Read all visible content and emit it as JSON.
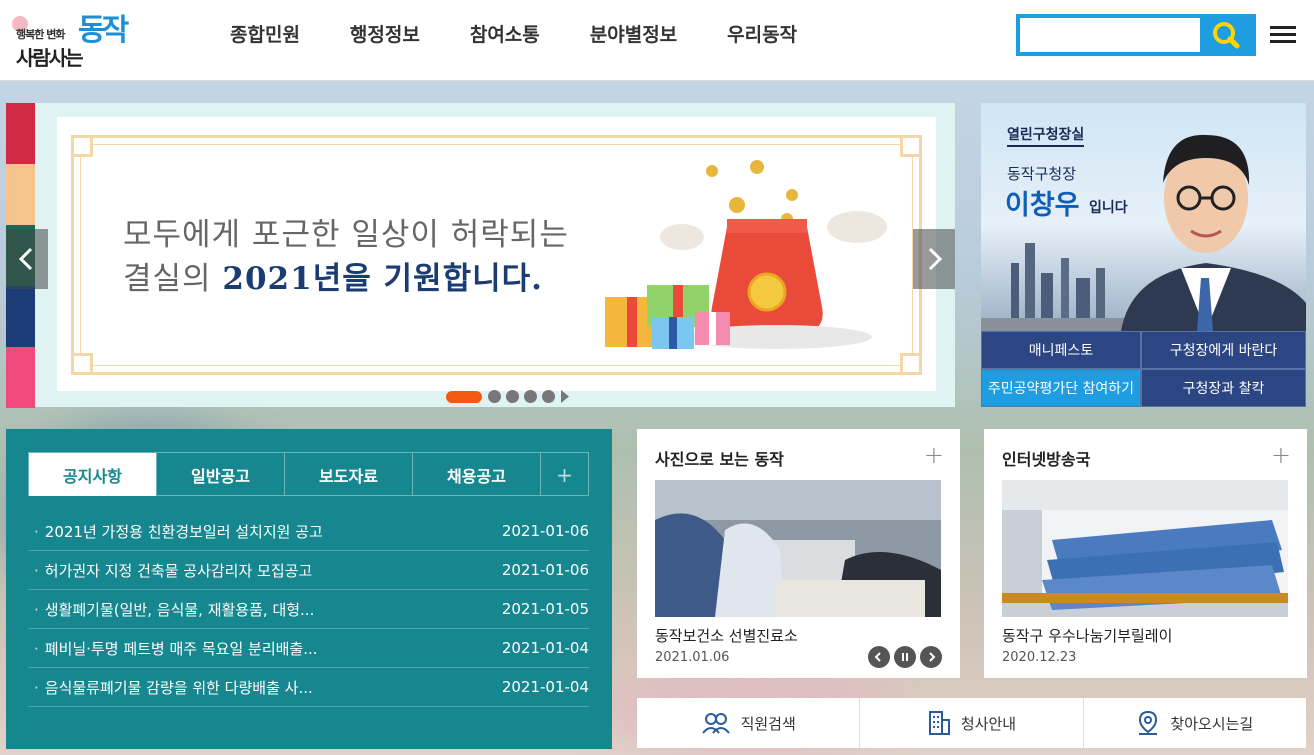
{
  "header": {
    "logo": {
      "small": "행복한 변화",
      "big": "사람사는",
      "brand": "동작"
    },
    "nav": [
      "종합민원",
      "행정정보",
      "참여소통",
      "분야별정보",
      "우리동작"
    ],
    "search": {
      "value": "",
      "placeholder": ""
    }
  },
  "visual": {
    "stripe_colors": [
      "#d22a45",
      "#f5c38d",
      "#1a6b56",
      "#1c3c78",
      "#f04a7c"
    ],
    "line1": "모두에게 포근한 일상이 허락되는",
    "line2_pre": "결실의 ",
    "line2_hl": "2021년을 기원합니다.",
    "slide_count": 5
  },
  "mayor": {
    "office": "열린구청장실",
    "role": "동작구청장",
    "name": "이창우",
    "suffix": "입니다",
    "links": [
      "매니페스토",
      "구청장에게 바란다",
      "주민공약평가단 참여하기",
      "구청장과 찰칵"
    ]
  },
  "notices": {
    "tabs": [
      "공지사항",
      "일반공고",
      "보도자료",
      "채용공고",
      "+"
    ],
    "items": [
      {
        "title": "2021년 가정용 친환경보일러 설치지원 공고",
        "date": "2021-01-06"
      },
      {
        "title": "허가권자 지정 건축물 공사감리자 모집공고",
        "date": "2021-01-06"
      },
      {
        "title": "생활폐기물(일반, 음식물, 재활용품, 대형...",
        "date": "2021-01-05"
      },
      {
        "title": "폐비닐·투명 페트병 매주 목요일 분리배출...",
        "date": "2021-01-04"
      },
      {
        "title": "음식물류폐기물 감량을 위한 다량배출 사...",
        "date": "2021-01-04"
      }
    ]
  },
  "photo": {
    "title": "사진으로 보는 동작",
    "plus": "+",
    "caption": "동작보건소 선별진료소",
    "date": "2021.01.06"
  },
  "broadcast": {
    "title": "인터넷방송국",
    "plus": "+",
    "caption": "동작구 우수나눔기부릴레이",
    "date": "2020.12.23"
  },
  "quick": [
    "직원검색",
    "청사안내",
    "찾아오시는길"
  ]
}
